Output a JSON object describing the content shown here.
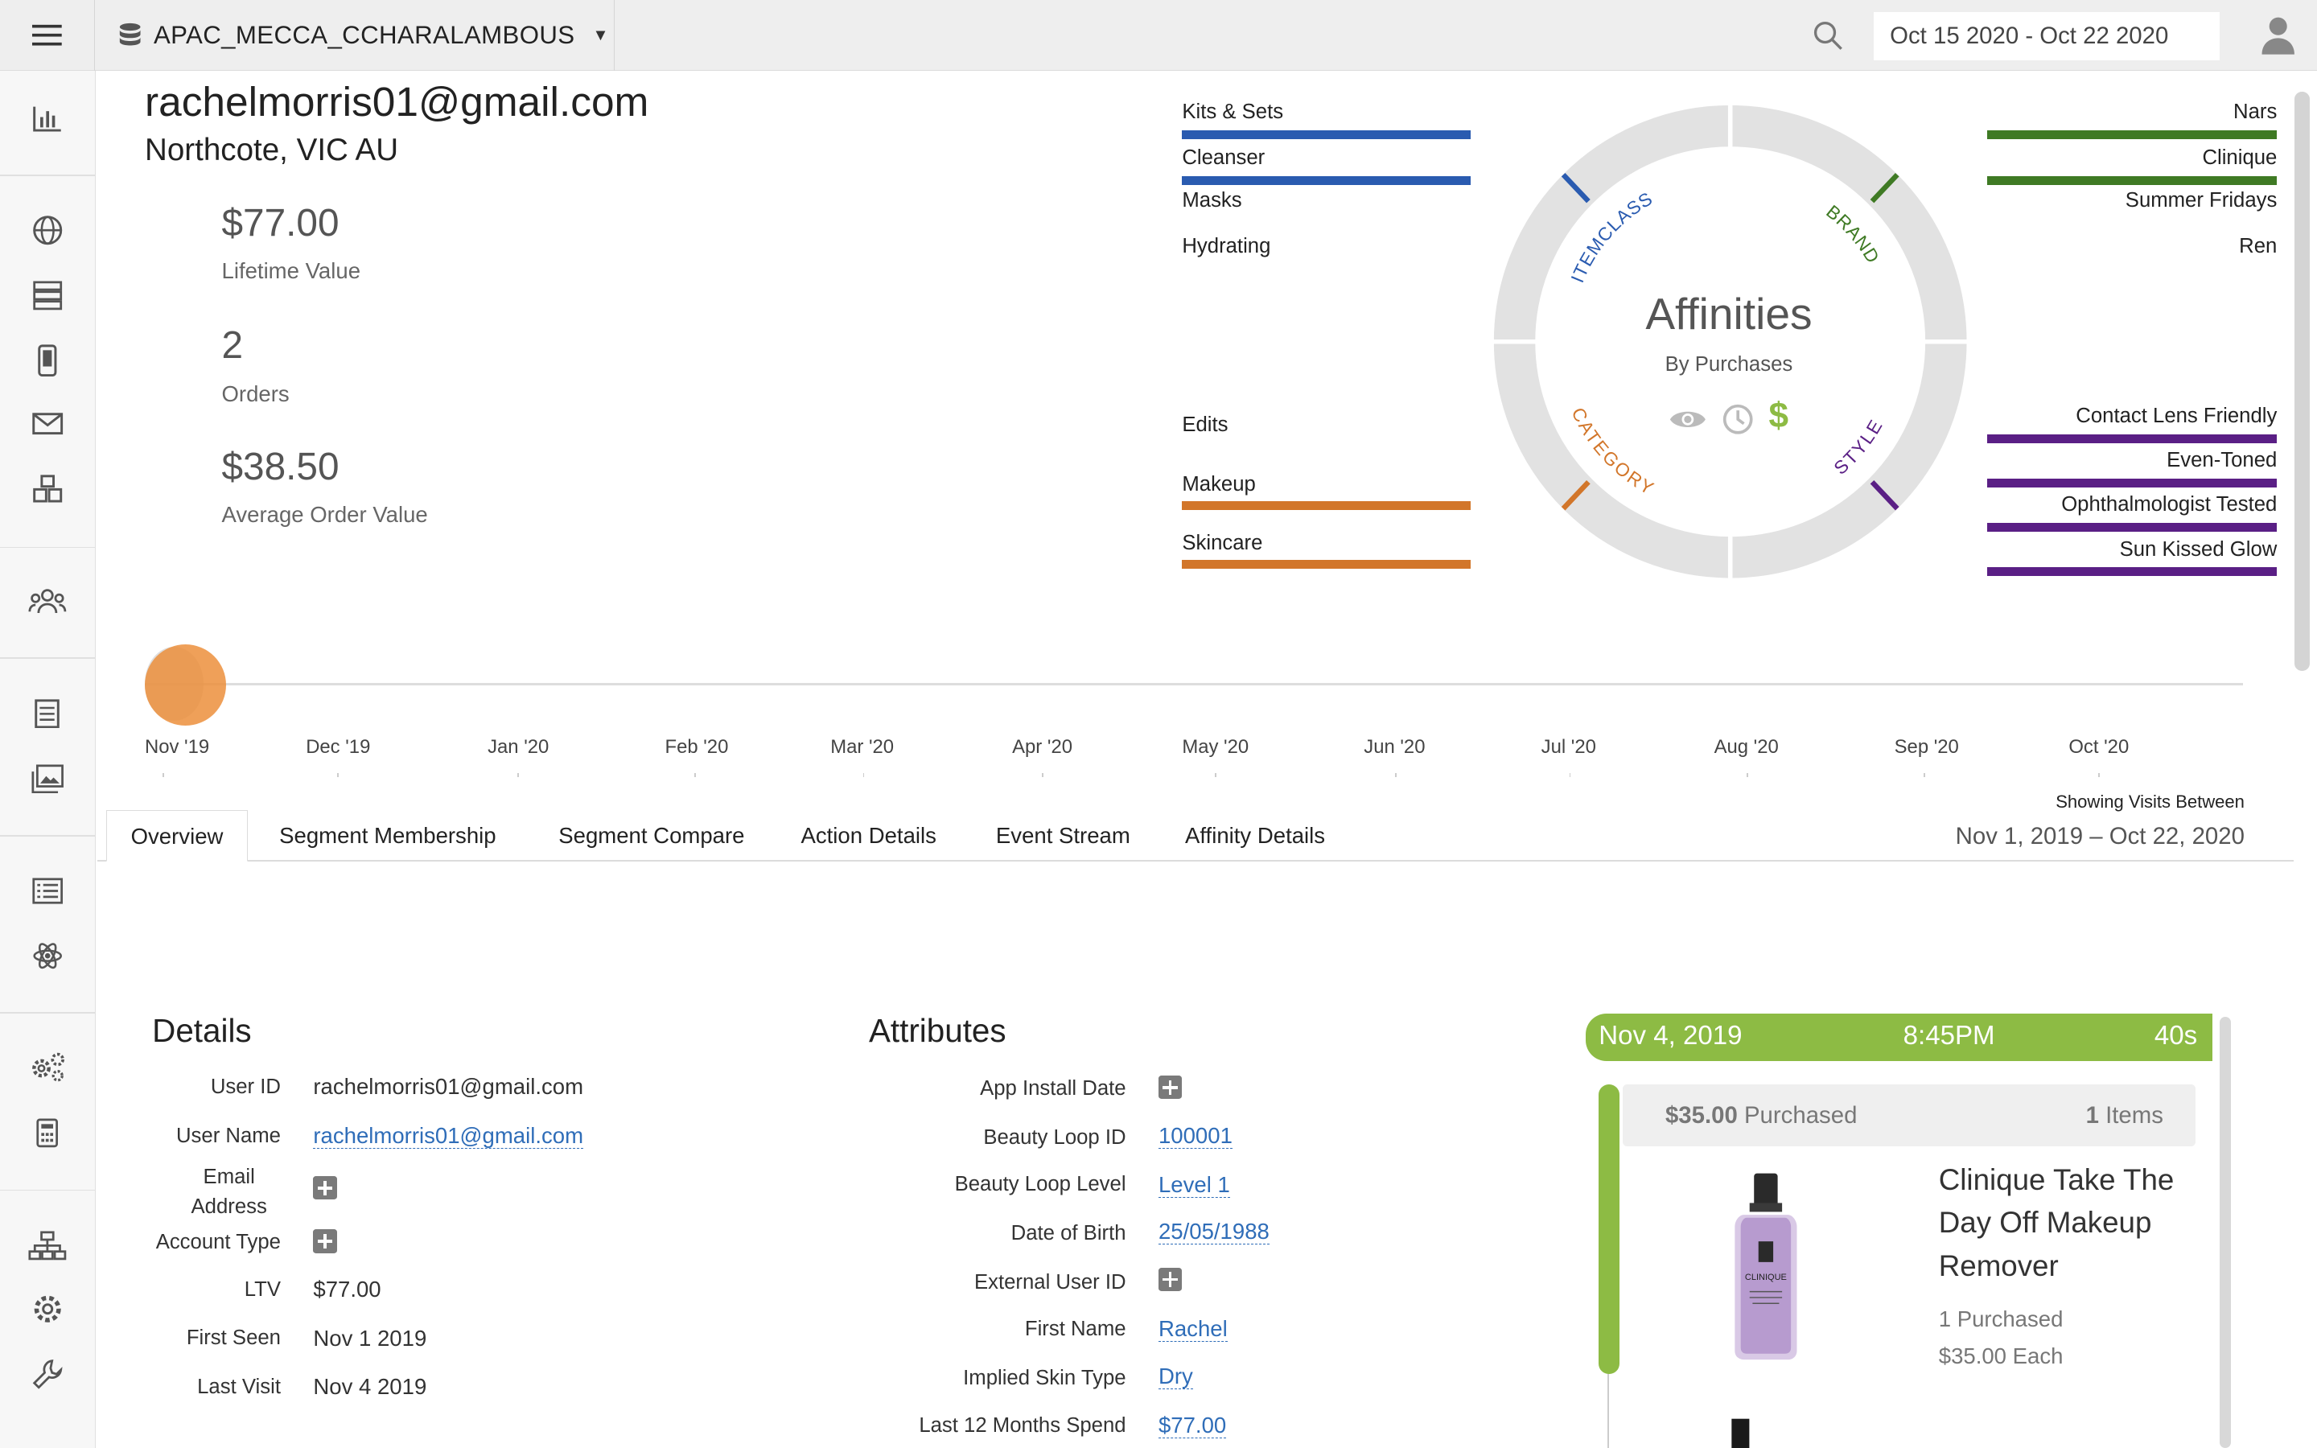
{
  "topbar": {
    "workspace": "APAC_MECCA_CCHARALAMBOUS",
    "date_range": "Oct 15 2020 - Oct 22 2020"
  },
  "profile": {
    "email": "rachelmorris01@gmail.com",
    "location": "Northcote, VIC AU",
    "kpis": [
      {
        "value": "$77.00",
        "label": "Lifetime Value"
      },
      {
        "value": "2",
        "label": "Orders"
      },
      {
        "value": "$38.50",
        "label": "Average Order Value"
      }
    ]
  },
  "affinities": {
    "title": "Affinities",
    "subtitle": "By Purchases",
    "ring_labels": {
      "itemclass": "ITEMCLASS",
      "brand": "BRAND",
      "category": "CATEGORY",
      "style": "STYLE"
    },
    "colors": {
      "itemclass": "#2a5bb0",
      "brand": "#3f7a24",
      "category": "#d2762a",
      "style": "#5a1f85"
    },
    "itemclass": [
      {
        "label": "Kits & Sets",
        "level": 1.0
      },
      {
        "label": "Cleanser",
        "level": 1.0
      },
      {
        "label": "Masks",
        "level": 0
      },
      {
        "label": "Hydrating",
        "level": 0
      }
    ],
    "brand": [
      {
        "label": "Nars",
        "level": 1.0
      },
      {
        "label": "Clinique",
        "level": 1.0
      },
      {
        "label": "Summer Fridays",
        "level": 0
      },
      {
        "label": "Ren",
        "level": 0
      }
    ],
    "category": [
      {
        "label": "Edits",
        "level": 0
      },
      {
        "label": "Makeup",
        "level": 1.0
      },
      {
        "label": "Skincare",
        "level": 1.0
      }
    ],
    "style": [
      {
        "label": "Contact Lens Friendly",
        "level": 1.0
      },
      {
        "label": "Even-Toned",
        "level": 1.0
      },
      {
        "label": "Ophthalmologist Tested",
        "level": 1.0
      },
      {
        "label": "Sun Kissed Glow",
        "level": 1.0
      }
    ],
    "mode_icons": [
      "eye-icon",
      "clock-icon",
      "dollar-icon"
    ]
  },
  "timeline": {
    "months": [
      "Nov '19",
      "Dec '19",
      "Jan '20",
      "Feb '20",
      "Mar '20",
      "Apr '20",
      "May '20",
      "Jun '20",
      "Jul '20",
      "Aug '20",
      "Sep '20",
      "Oct '20"
    ],
    "visits_caption": "Showing Visits Between",
    "visits_range": "Nov 1, 2019  –  Oct 22, 2020"
  },
  "tabs": [
    "Overview",
    "Segment Membership",
    "Segment Compare",
    "Action Details",
    "Event Stream",
    "Affinity Details"
  ],
  "details": {
    "title": "Details",
    "rows": [
      {
        "label": "User ID",
        "value": "rachelmorris01@gmail.com"
      },
      {
        "label": "User Name",
        "value": "rachelmorris01@gmail.com"
      },
      {
        "label": "Email Address",
        "value": ""
      },
      {
        "label": "Account Type",
        "value": ""
      },
      {
        "label": "LTV",
        "value": "$77.00"
      },
      {
        "label": "First Seen",
        "value": "Nov 1 2019"
      },
      {
        "label": "Last Visit",
        "value": "Nov 4 2019"
      }
    ]
  },
  "attributes": {
    "title": "Attributes",
    "rows": [
      {
        "label": "App Install Date",
        "value": ""
      },
      {
        "label": "Beauty Loop ID",
        "value": "100001"
      },
      {
        "label": "Beauty Loop Level",
        "value": "Level 1"
      },
      {
        "label": "Date of Birth",
        "value": "25/05/1988"
      },
      {
        "label": "External User ID",
        "value": ""
      },
      {
        "label": "First Name",
        "value": "Rachel"
      },
      {
        "label": "Implied Skin Type",
        "value": "Dry"
      },
      {
        "label": "Last 12 Months Spend",
        "value": "$77.00"
      }
    ]
  },
  "event": {
    "date": "Nov 4, 2019",
    "time": "8:45PM",
    "duration": "40s",
    "purchase_amount": "$35.00",
    "purchase_word": "Purchased",
    "items_count": "1",
    "items_word": "Items",
    "product_name": "Clinique Take The Day Off Makeup Remover",
    "product_brand_mark": "CLINIQUE",
    "product_qty": "1 Purchased",
    "product_price": "$35.00 Each"
  }
}
